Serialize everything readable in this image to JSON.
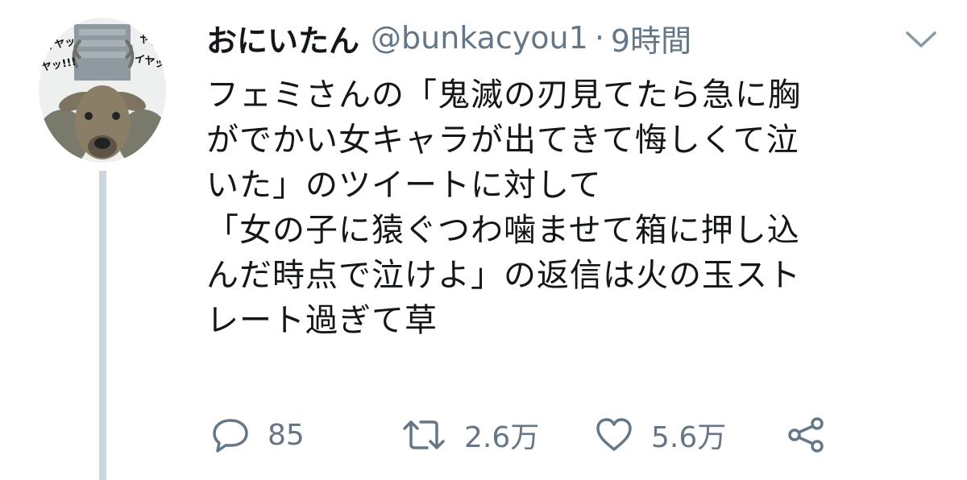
{
  "tweet": {
    "display_name": "おにいたん",
    "handle": "@bunkacyou1",
    "separator": "·",
    "time": "9時間",
    "text": "フェミさんの「鬼滅の刃見てたら急に胸\nがでかい女キャラが出てきて悔しくて泣\nいた」のツイートに対して\n「女の子に猿ぐつわ噛ませて箱に押し込\nんだ時点で泣けよ」の返信は火の玉スト\nレート過ぎて草",
    "avatar_text": {
      "left": "イヤッ\nヤッ!!!",
      "right": "ヤッ\nイヤッ!!"
    }
  },
  "actions": {
    "reply_icon": "reply-icon",
    "reply_count": "85",
    "retweet_icon": "retweet-icon",
    "retweet_count": "2.6万",
    "like_icon": "heart-icon",
    "like_count": "5.6万",
    "share_icon": "share-icon"
  },
  "colors": {
    "text": "#14171a",
    "secondary": "#657786",
    "thread_line": "#ccd6dd"
  }
}
